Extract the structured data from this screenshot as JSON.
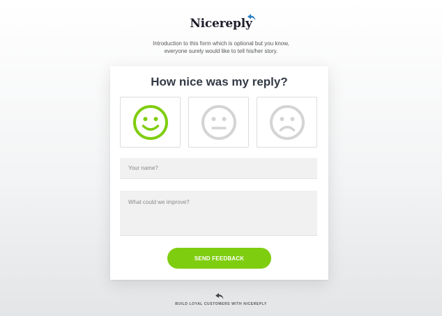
{
  "brand": {
    "name": "Nicereply",
    "logo_icon": "reply-arrow-icon",
    "accent": "#7fcd0f",
    "mark_color": "#2b7fc1"
  },
  "intro": {
    "line1": "Introduction to this form which is optional but you know,",
    "line2": "everyone surely would like to tell his/her story."
  },
  "card": {
    "question": "How nice was my reply?",
    "ratings": [
      {
        "icon": "happy-face-icon",
        "selected": true
      },
      {
        "icon": "neutral-face-icon",
        "selected": false
      },
      {
        "icon": "sad-face-icon",
        "selected": false
      }
    ],
    "name_placeholder": "Your name?",
    "improve_placeholder": "What could we improve?",
    "send_label": "SEND FEEDBACK"
  },
  "footer": {
    "icon": "reply-arrow-icon",
    "text": "BUILD LOYAL CUSTOMERS WITH NICEREPLY"
  }
}
